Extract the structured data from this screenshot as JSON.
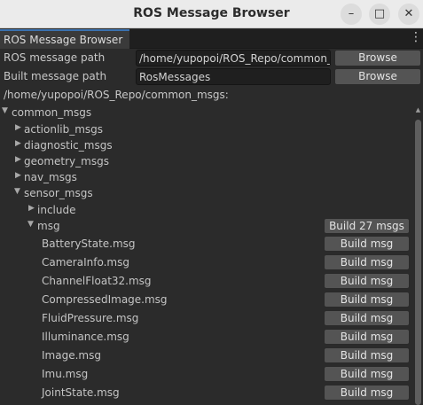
{
  "window": {
    "title": "ROS Message Browser",
    "controls": {
      "minimize": "–",
      "maximize": "□",
      "close": "✕"
    }
  },
  "tab": {
    "label": "ROS Message Browser",
    "menu_glyph": "⋮"
  },
  "form": {
    "ros_message_path": {
      "label": "ROS message path",
      "value": "/home/yupopoi/ROS_Repo/common_m",
      "button": "Browse"
    },
    "built_message_path": {
      "label": "Built message path",
      "value": "RosMessages",
      "button": "Browse"
    }
  },
  "current_path": "/home/yupopoi/ROS_Repo/common_msgs:",
  "tree": {
    "expanded_glyph": "▼",
    "collapsed_glyph": "▶",
    "nodes": [
      {
        "label": "common_msgs",
        "state": "expanded"
      },
      {
        "label": "actionlib_msgs",
        "state": "collapsed"
      },
      {
        "label": "diagnostic_msgs",
        "state": "collapsed"
      },
      {
        "label": "geometry_msgs",
        "state": "collapsed"
      },
      {
        "label": "nav_msgs",
        "state": "collapsed"
      },
      {
        "label": "sensor_msgs",
        "state": "expanded"
      },
      {
        "label": "include",
        "state": "collapsed"
      },
      {
        "label": "msg",
        "state": "expanded",
        "button": "Build 27 msgs"
      },
      {
        "label": "BatteryState.msg",
        "button": "Build msg"
      },
      {
        "label": "CameraInfo.msg",
        "button": "Build msg"
      },
      {
        "label": "ChannelFloat32.msg",
        "button": "Build msg"
      },
      {
        "label": "CompressedImage.msg",
        "button": "Build msg"
      },
      {
        "label": "FluidPressure.msg",
        "button": "Build msg"
      },
      {
        "label": "Illuminance.msg",
        "button": "Build msg"
      },
      {
        "label": "Image.msg",
        "button": "Build msg"
      },
      {
        "label": "Imu.msg",
        "button": "Build msg"
      },
      {
        "label": "JointState.msg",
        "button": "Build msg"
      }
    ]
  },
  "scrollbar": {
    "up_glyph": "▲"
  }
}
